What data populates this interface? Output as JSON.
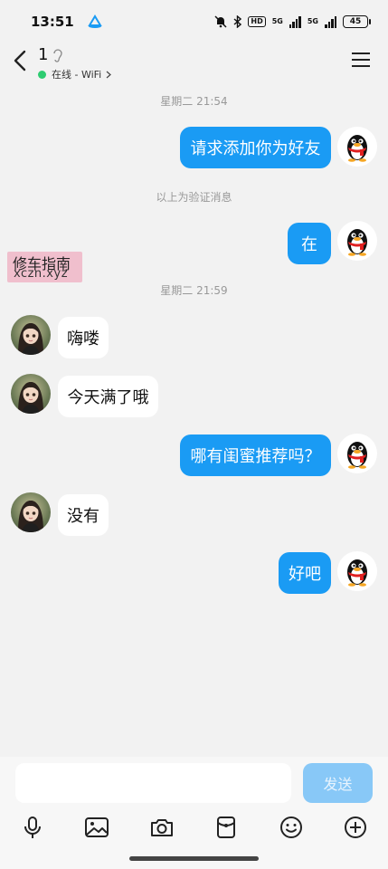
{
  "status_bar": {
    "time": "13:51",
    "hd_label": "HD",
    "net1_label": "5G",
    "net2_label": "5G",
    "battery_level": "45"
  },
  "header": {
    "contact_name": "1",
    "online_status": "在线 - WiFi"
  },
  "messages": {
    "timestamp1": "星期二 21:54",
    "m1": "请求添加你为好友",
    "system_note": "以上为验证消息",
    "m2": "在",
    "timestamp2": "星期二 21:59",
    "m3": "嗨喽",
    "m4": "今天满了哦",
    "m5": "哪有闺蜜推荐吗？",
    "m6": "没有",
    "m7": "好吧"
  },
  "watermark": {
    "line1": "修车指南",
    "line2": "xczn.xyz"
  },
  "input_bar": {
    "value": "",
    "send_label": "发送"
  },
  "colors": {
    "outgoing_bubble": "#1a9bf4",
    "incoming_bubble": "#ffffff",
    "background": "#f2f2f2",
    "online_dot": "#2ecc71",
    "send_button_disabled": "#88c8f7"
  },
  "icons": {
    "toolbar": [
      "microphone-icon",
      "image-icon",
      "camera-icon",
      "red-packet-icon",
      "emoji-icon",
      "plus-icon"
    ]
  }
}
